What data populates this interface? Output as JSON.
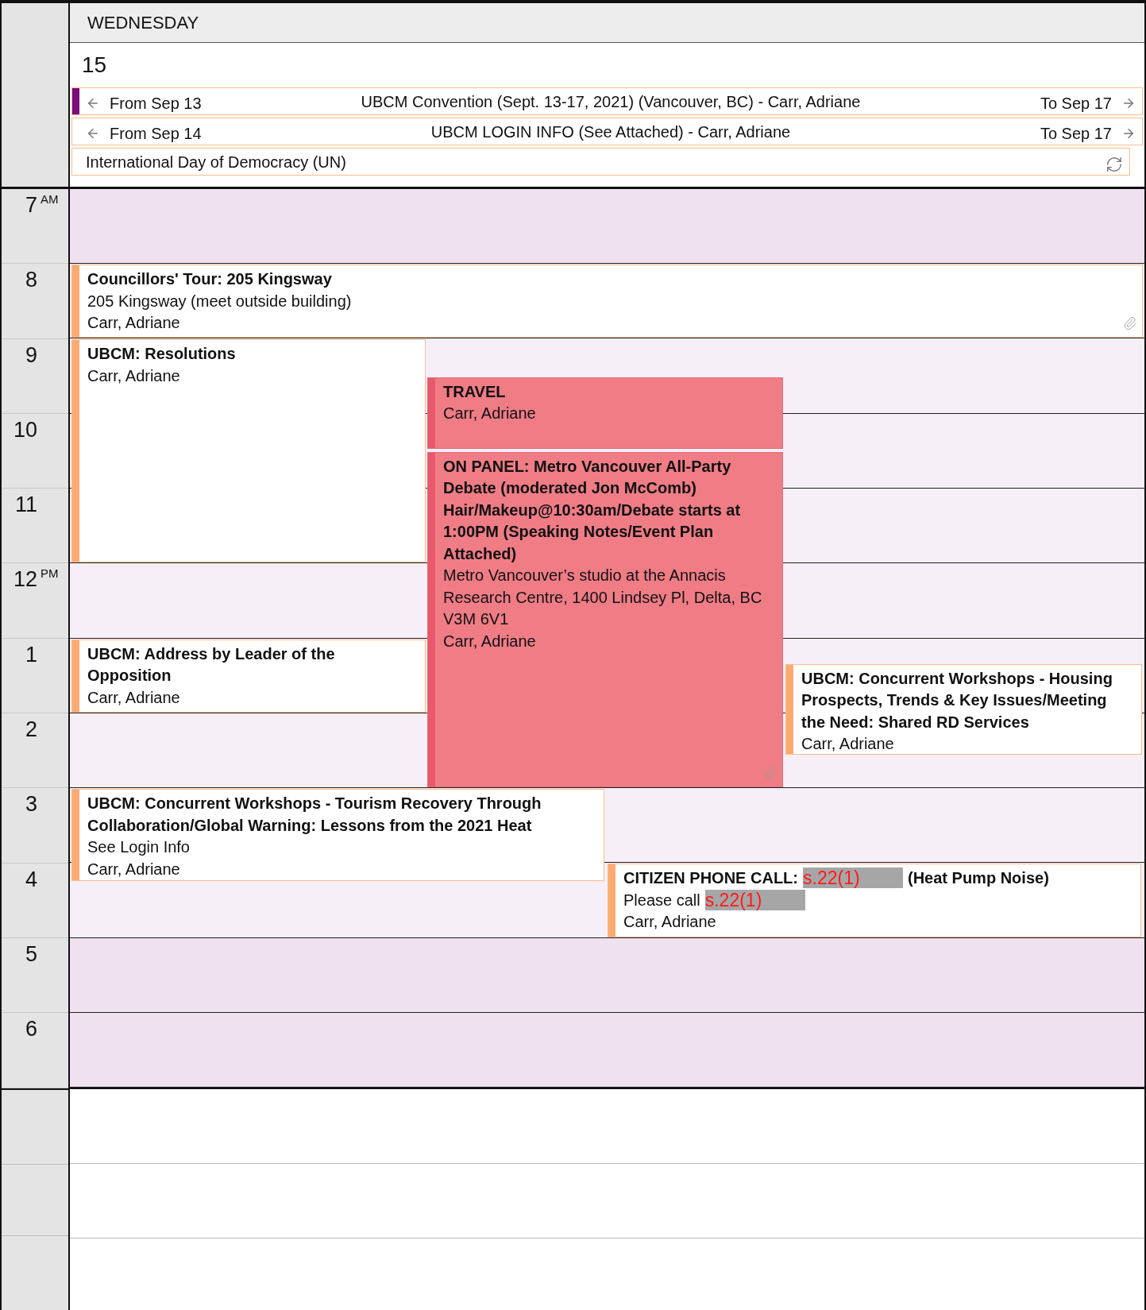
{
  "day_header": {
    "weekday": "WEDNESDAY",
    "date": "15"
  },
  "all_day_events": [
    {
      "from": "From Sep 13",
      "title": "UBCM Convention (Sept. 13-17, 2021) (Vancouver, BC) - Carr, Adriane",
      "to": "To Sep 17",
      "color": "#7b0d7c",
      "recurring": false
    },
    {
      "from": "From Sep 14",
      "title": "UBCM LOGIN INFO (See Attached) - Carr, Adriane",
      "to": "To Sep 17",
      "recurring": false
    },
    {
      "title": "International Day of Democracy (UN)",
      "recurring": true
    }
  ],
  "hours": [
    {
      "label": "7",
      "suffix": "AM",
      "working": false
    },
    {
      "label": "8",
      "working": true
    },
    {
      "label": "9",
      "working": true
    },
    {
      "label": "10",
      "working": true
    },
    {
      "label": "11",
      "working": true
    },
    {
      "label": "12",
      "suffix": "PM",
      "working": true
    },
    {
      "label": "1",
      "working": true
    },
    {
      "label": "2",
      "working": true
    },
    {
      "label": "3",
      "working": true
    },
    {
      "label": "4",
      "working": true
    },
    {
      "label": "5",
      "working": false
    },
    {
      "label": "6",
      "working": false
    }
  ],
  "events": [
    {
      "title": [
        {
          "kind": "text",
          "text": "Councillors' Tour: 205 Kingsway"
        }
      ],
      "details": [
        [
          {
            "kind": "text",
            "text": "205 Kingsway (meet outside building)"
          }
        ],
        [
          {
            "kind": "text",
            "text": "Carr, Adriane"
          }
        ]
      ],
      "color": "#fbab72",
      "filled": false,
      "attachment": true
    },
    {
      "title": [
        {
          "kind": "text",
          "text": "UBCM: Resolutions"
        }
      ],
      "details": [
        [
          {
            "kind": "text",
            "text": "Carr, Adriane"
          }
        ]
      ],
      "color": "#fbab72",
      "filled": false,
      "attachment": false
    },
    {
      "title": [
        {
          "kind": "text",
          "text": "TRAVEL"
        }
      ],
      "details": [
        [
          {
            "kind": "text",
            "text": "Carr, Adriane"
          }
        ]
      ],
      "color": "#e85a6b",
      "filled": true,
      "attachment": false
    },
    {
      "title": [
        {
          "kind": "text",
          "text": "ON PANEL: Metro Vancouver All-Party Debate (moderated Jon McComb) Hair/Makeup@10:30am/Debate starts at 1:00PM (Speaking Notes/Event Plan Attached)"
        }
      ],
      "details": [
        [
          {
            "kind": "text",
            "text": "Metro Vancouver’s studio at the Annacis Research Centre, 1400 Lindsey Pl, Delta, BC V3M 6V1"
          }
        ],
        [
          {
            "kind": "text",
            "text": "Carr, Adriane"
          }
        ]
      ],
      "color": "#e85a6b",
      "filled": true,
      "attachment": true
    },
    {
      "title": [
        {
          "kind": "text",
          "text": "UBCM: Address by Leader of the Opposition"
        }
      ],
      "details": [
        [
          {
            "kind": "text",
            "text": "Carr, Adriane"
          }
        ]
      ],
      "color": "#fbab72",
      "filled": false,
      "attachment": false
    },
    {
      "title": [
        {
          "kind": "text",
          "text": "UBCM: Concurrent Workshops - Housing Prospects, Trends & Key Issues/Meeting the Need: Shared RD Services"
        }
      ],
      "details": [
        [
          {
            "kind": "text",
            "text": "Carr, Adriane"
          }
        ]
      ],
      "color": "#fbab72",
      "filled": false,
      "attachment": false
    },
    {
      "title": [
        {
          "kind": "text",
          "text": "UBCM: Concurrent Workshops - Tourism Recovery Through Collaboration/Global Warning: Lessons from the 2021 Heat"
        }
      ],
      "details": [
        [
          {
            "kind": "text",
            "text": "See Login Info"
          }
        ],
        [
          {
            "kind": "text",
            "text": "Carr, Adriane"
          }
        ]
      ],
      "color": "#fbab72",
      "filled": false,
      "attachment": false
    },
    {
      "title": [
        {
          "kind": "text",
          "text": "CITIZEN PHONE CALL:"
        },
        {
          "kind": "redaction",
          "text": "s.22(1)"
        },
        {
          "kind": "text",
          "text": "(Heat Pump Noise)"
        }
      ],
      "details": [
        [
          {
            "kind": "text",
            "text": "Please call"
          },
          {
            "kind": "redaction",
            "text": "s.22(1)"
          }
        ],
        [
          {
            "kind": "text",
            "text": "Carr, Adriane"
          }
        ]
      ],
      "color": "#fbab72",
      "filled": false,
      "attachment": false
    }
  ]
}
